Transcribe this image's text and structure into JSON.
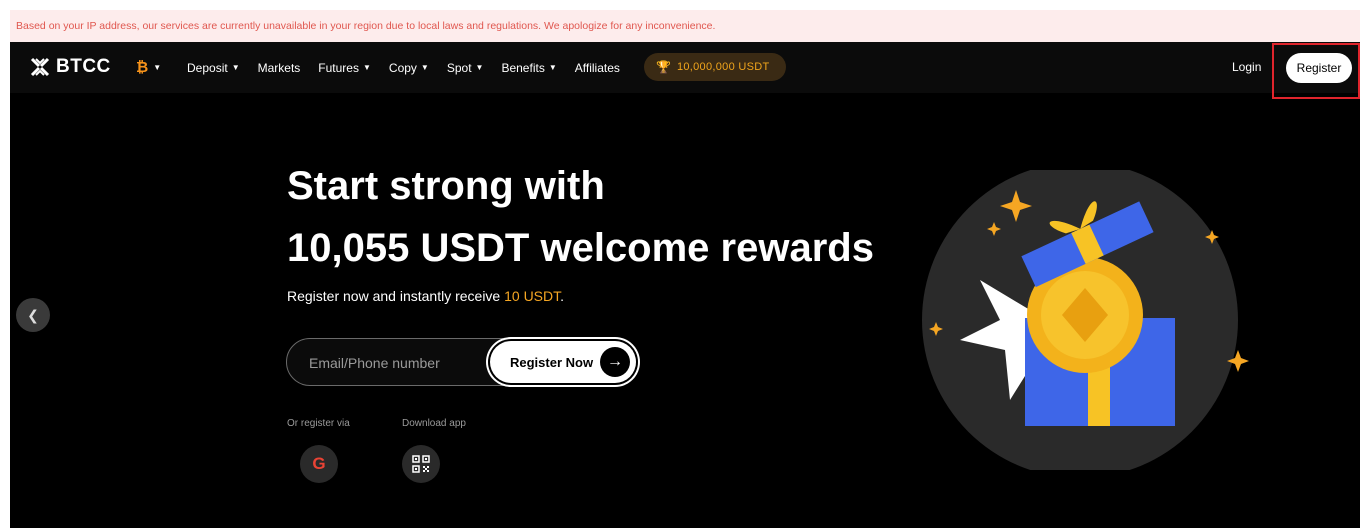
{
  "banner": {
    "text": "Based on your IP address, our services are currently unavailable in your region due to local laws and regulations. We apologize for any inconvenience."
  },
  "nav": {
    "logo_text": "BTCC",
    "coin_icon": "bitcoin-icon",
    "items": [
      {
        "label": "Deposit",
        "has_dropdown": true
      },
      {
        "label": "Markets",
        "has_dropdown": false
      },
      {
        "label": "Futures",
        "has_dropdown": true
      },
      {
        "label": "Copy",
        "has_dropdown": true
      },
      {
        "label": "Spot",
        "has_dropdown": true
      },
      {
        "label": "Benefits",
        "has_dropdown": true
      },
      {
        "label": "Affiliates",
        "has_dropdown": false
      }
    ],
    "promo": "10,000,000 USDT",
    "login": "Login",
    "register": "Register"
  },
  "hero": {
    "title_line1": "Start strong with",
    "title_line2": "10,055 USDT welcome rewards",
    "subtitle_prefix": "Register now and instantly receive ",
    "subtitle_accent": "10 USDT",
    "subtitle_suffix": ".",
    "email_placeholder": "Email/Phone number",
    "register_now": "Register Now",
    "or_register_via": "Or register via",
    "download_app": "Download app"
  },
  "colors": {
    "accent": "#f5a623",
    "banner_text": "#e0574f",
    "highlight": "#e0242c"
  }
}
